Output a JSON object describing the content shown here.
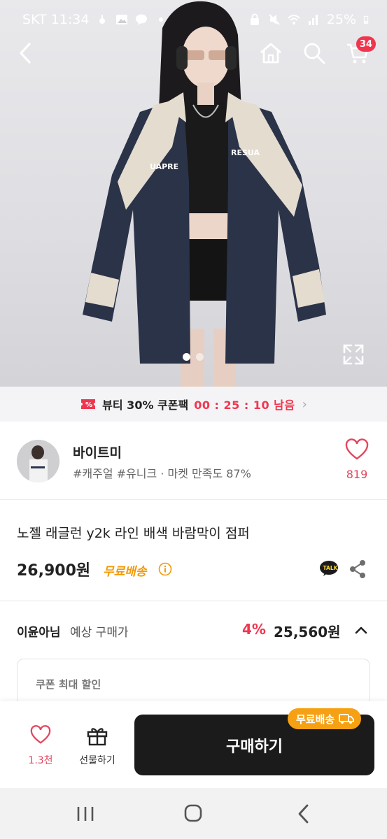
{
  "status_bar": {
    "carrier_time": "SKT 11:34",
    "battery": "25%"
  },
  "top_nav": {
    "cart_count": "34"
  },
  "coupon_banner": {
    "label": "뷰티 30% 쿠폰팩",
    "timer": "00 : 25 : 10 남음"
  },
  "shop": {
    "name": "바이트미",
    "tags": "#캐주얼 #유니크 · 마켓 만족도 87%",
    "like_count": "819"
  },
  "product": {
    "title": "노젤 래글런 y2k 라인 배색 바람막이 점퍼",
    "price": "26,900원",
    "free_shipping": "무료배송",
    "talk_icon_text": "TALK"
  },
  "expected_price": {
    "user_name": "이윤아님",
    "label": "예상 구매가",
    "discount": "4%",
    "price": "25,560원"
  },
  "coupon_box": {
    "label": "쿠폰 최대 할인"
  },
  "action_bar": {
    "like_count": "1.3천",
    "gift_label": "선물하기",
    "buy_label": "구매하기",
    "buy_badge": "무료배송"
  },
  "hero": {
    "jacket_text_left": "UAPRE",
    "jacket_text_right": "RESUA"
  },
  "colors": {
    "accent": "#f0364f",
    "free_ship": "#f29a05",
    "buy_button": "#1b1b1b"
  }
}
